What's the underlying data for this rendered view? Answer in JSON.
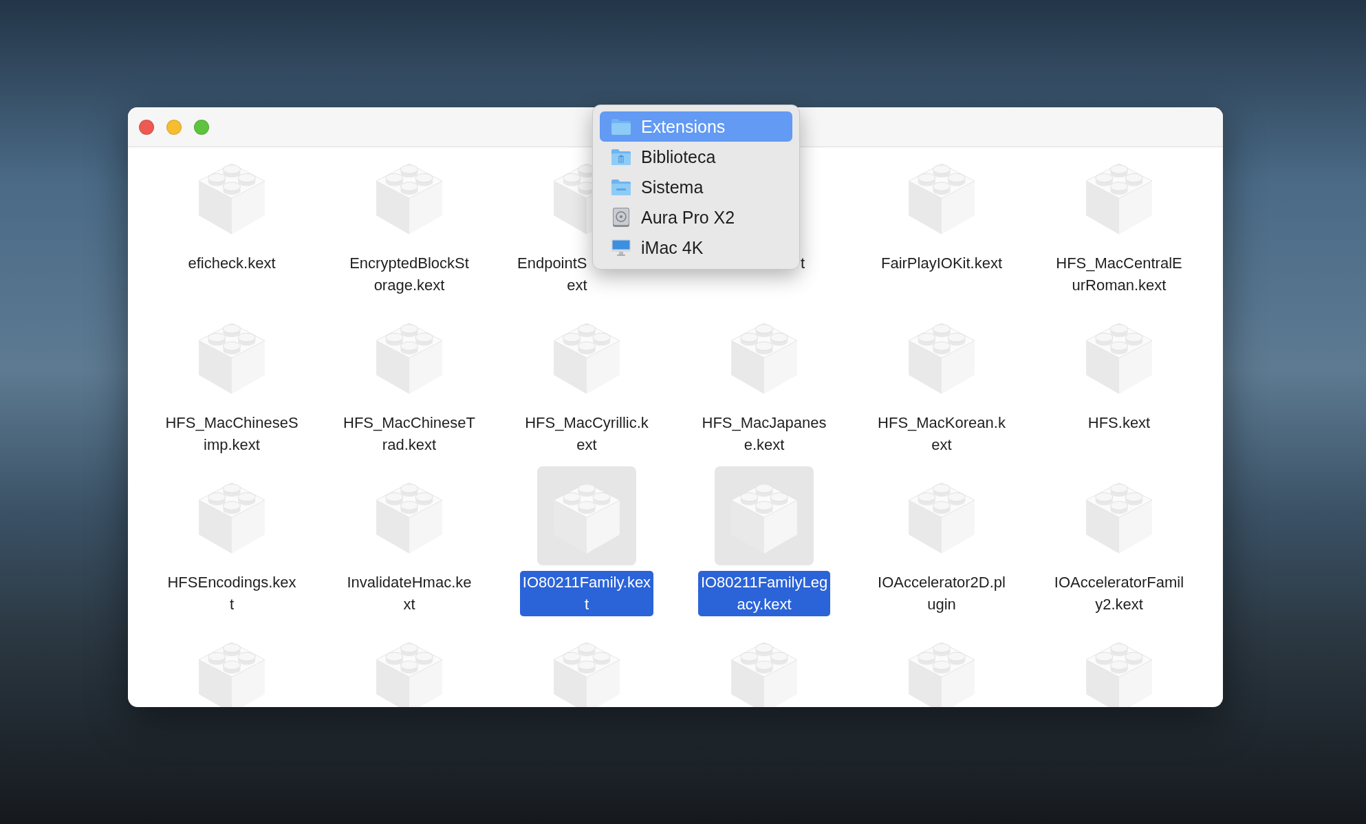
{
  "window": {
    "controls": [
      {
        "kind": "close"
      },
      {
        "kind": "minimize"
      },
      {
        "kind": "zoom"
      }
    ]
  },
  "path_menu": {
    "items": [
      {
        "label": "Extensions",
        "kind": "folder",
        "selected": true
      },
      {
        "label": "Biblioteca",
        "kind": "library",
        "selected": false
      },
      {
        "label": "Sistema",
        "kind": "system",
        "selected": false
      },
      {
        "label": "Aura Pro X2",
        "kind": "disk",
        "selected": false
      },
      {
        "label": "iMac 4K",
        "kind": "computer",
        "selected": false
      }
    ]
  },
  "files": [
    {
      "kind": "kext",
      "lines": [
        "eficheck.kext"
      ],
      "selected": false
    },
    {
      "kind": "kext",
      "lines": [
        "EncryptedBlockSt",
        "orage.kext"
      ],
      "selected": false
    },
    {
      "kind": "covered-right",
      "lines": [
        "EndpointS",
        "ext"
      ],
      "selected": false
    },
    {
      "kind": "covered-left",
      "lines": [
        "t"
      ],
      "selected": false
    },
    {
      "kind": "kext",
      "lines": [
        "FairPlayIOKit.kext"
      ],
      "selected": false
    },
    {
      "kind": "kext",
      "lines": [
        "HFS_MacCentralE",
        "urRoman.kext"
      ],
      "selected": false
    },
    {
      "kind": "kext",
      "lines": [
        "HFS_MacChineseS",
        "imp.kext"
      ],
      "selected": false
    },
    {
      "kind": "kext",
      "lines": [
        "HFS_MacChineseT",
        "rad.kext"
      ],
      "selected": false
    },
    {
      "kind": "kext",
      "lines": [
        "HFS_MacCyrillic.k",
        "ext"
      ],
      "selected": false
    },
    {
      "kind": "kext",
      "lines": [
        "HFS_MacJapanes",
        "e.kext"
      ],
      "selected": false
    },
    {
      "kind": "kext",
      "lines": [
        "HFS_MacKorean.k",
        "ext"
      ],
      "selected": false
    },
    {
      "kind": "kext",
      "lines": [
        "HFS.kext"
      ],
      "selected": false
    },
    {
      "kind": "kext",
      "lines": [
        "HFSEncodings.kex",
        "t"
      ],
      "selected": false
    },
    {
      "kind": "kext",
      "lines": [
        "InvalidateHmac.ke",
        "xt"
      ],
      "selected": false
    },
    {
      "kind": "kext",
      "lines": [
        "IO80211Family.kex",
        "t"
      ],
      "selected": true
    },
    {
      "kind": "kext",
      "lines": [
        "IO80211FamilyLeg",
        "acy.kext"
      ],
      "selected": true
    },
    {
      "kind": "kext",
      "lines": [
        "IOAccelerator2D.pl",
        "ugin"
      ],
      "selected": false
    },
    {
      "kind": "kext",
      "lines": [
        "IOAcceleratorFamil",
        "y2.kext"
      ],
      "selected": false
    },
    {
      "kind": "kext",
      "selected": false
    },
    {
      "kind": "kext",
      "selected": false
    },
    {
      "kind": "kext",
      "selected": false
    },
    {
      "kind": "kext",
      "selected": false
    },
    {
      "kind": "kext",
      "selected": false
    },
    {
      "kind": "kext",
      "selected": false
    }
  ]
}
